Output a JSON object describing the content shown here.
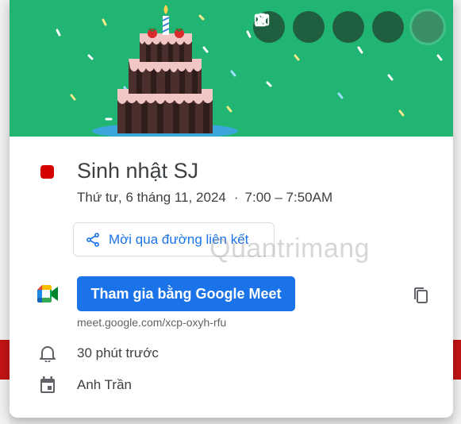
{
  "event": {
    "title": "Sinh nhật SJ",
    "date": "Thứ tư, 6 tháng 11, 2024",
    "separator": "·",
    "time": "7:00 – 7:50AM",
    "color": "#d50000"
  },
  "banner": {
    "background_color": "#21b573"
  },
  "actions": {
    "edit_icon": "pencil-icon",
    "delete_icon": "trash-icon",
    "email_icon": "mail-icon",
    "more_icon": "more-vert-icon",
    "close_icon": "close-icon"
  },
  "share": {
    "label": "Mời qua đường liên kết",
    "icon": "share-icon"
  },
  "meet": {
    "button_label": "Tham gia bằng Google Meet",
    "link": "meet.google.com/xcp-oxyh-rfu",
    "accent": "#1a73e8"
  },
  "reminder": {
    "text": "30 phút trước",
    "icon": "bell-icon"
  },
  "calendar": {
    "owner": "Anh Trần",
    "icon": "calendar-icon"
  },
  "watermark": {
    "text": "Quantrimang"
  }
}
